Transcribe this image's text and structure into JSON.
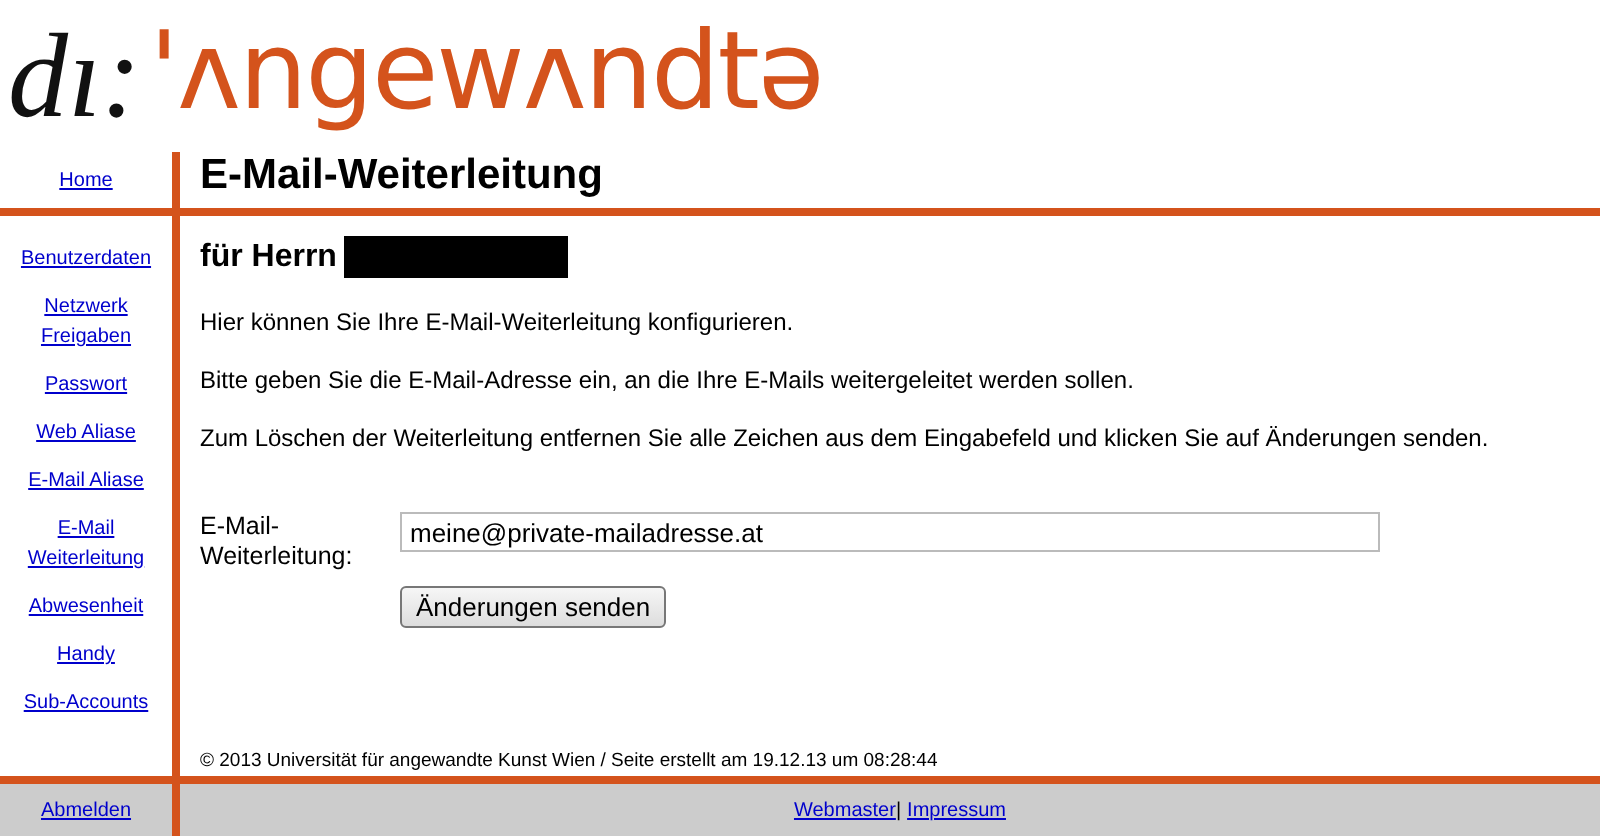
{
  "logo": {
    "prefix": "dı:",
    "name": "'ʌngewʌndtə"
  },
  "nav_top": {
    "label": "Home"
  },
  "page_title": "E-Mail-Weiterleitung",
  "sidebar": {
    "items": [
      {
        "label": "Benutzerdaten"
      },
      {
        "label": "Netzwerk Freigaben"
      },
      {
        "label": "Passwort"
      },
      {
        "label": "Web Aliase"
      },
      {
        "label": "E-Mail Aliase"
      },
      {
        "label": "E-Mail Weiterleitung"
      },
      {
        "label": "Abwesenheit"
      },
      {
        "label": "Handy"
      },
      {
        "label": "Sub-Accounts"
      }
    ]
  },
  "greeting": "für Herrn",
  "paragraphs": [
    "Hier können Sie Ihre E-Mail-Weiterleitung konfigurieren.",
    "Bitte geben Sie die E-Mail-Adresse ein, an die Ihre E-Mails weitergeleitet werden sollen.",
    "Zum Löschen der Weiterleitung entfernen Sie alle Zeichen aus dem Eingabefeld und klicken Sie auf Änderungen senden."
  ],
  "form": {
    "label": "E-Mail-Weiterleitung:",
    "value": "meine@private-mailadresse.at",
    "submit": "Änderungen senden"
  },
  "copyright": "© 2013 Universität für angewandte Kunst Wien / Seite erstellt am 19.12.13 um 08:28:44",
  "footer": {
    "logout": "Abmelden",
    "links": [
      "Webmaster",
      "Impressum"
    ],
    "separator": "|"
  }
}
